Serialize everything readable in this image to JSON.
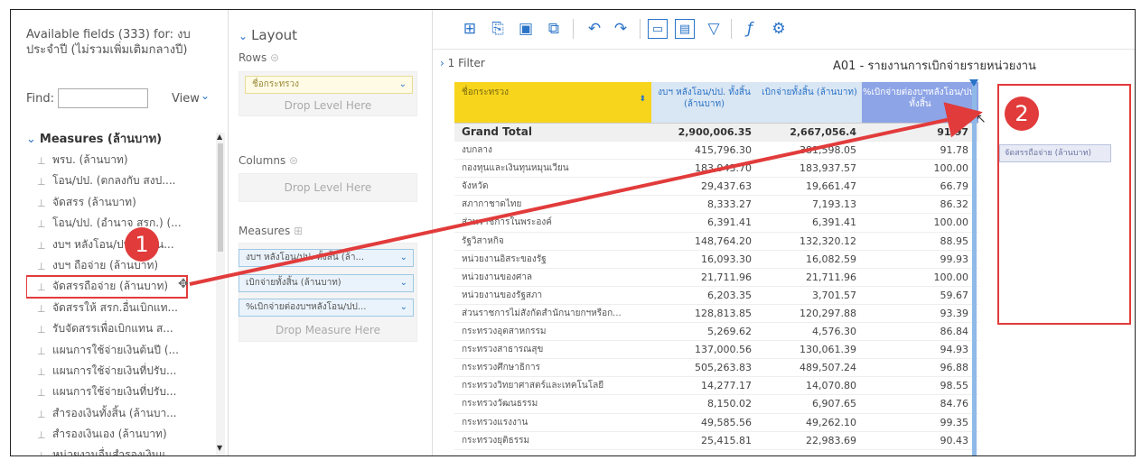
{
  "fields_panel": {
    "title": "Available fields (333) for: งบประจำปี (ไม่รวมเพิ่มเติมกลางปี)",
    "find_label": "Find:",
    "find_value": "",
    "view_label": "View",
    "group_label": "Measures (ล้านบาท)",
    "items": [
      "พรบ. (ล้านบาท)",
      "โอน/ปป. (ตกลงกับ สงป....",
      "จัดสรร (ล้านบาท)",
      "โอน/ปป. (อำนาจ สรก.) (...",
      "งบฯ หลังโอน/ปป. ทั้งสิ้น...",
      "งบฯ ถือจ่าย (ล้านบาท)",
      "จัดสรรถือจ่าย (ล้านบาท)",
      "จัดสรรให้ สรก.อื่นเบิกแท...",
      "รับจัดสรรเพื่อเบิกแทน ส...",
      "แผนการใช้จ่ายเงินต้นปี (...",
      "แผนการใช้จ่ายเงินที่ปรับ...",
      "แผนการใช้จ่ายเงินที่ปรับ...",
      "สำรองเงินทั้งสิ้น (ล้านบา...",
      "สำรองเงินเอง (ล้านบาท)",
      "หน่วยงานอื่นสำรองเงินแ..."
    ]
  },
  "layout_panel": {
    "title": "Layout",
    "rows_label": "Rows",
    "rows_pill": "ชื่อกระทรวง",
    "rows_drop": "Drop Level Here",
    "columns_label": "Columns",
    "columns_drop": "Drop Level Here",
    "measures_label": "Measures",
    "measure_pills": [
      "งบฯ หลังโอน/ปป. ทั้งสิ้น (ล้า...",
      "เบิกจ่ายทั้งสิ้น (ล้านบาท)",
      "%เบิกจ่ายต่องบฯหลังโอน/ปป..."
    ],
    "measures_drop": "Drop Measure Here"
  },
  "toolbar": {
    "icons": [
      "new-icon",
      "open-icon",
      "save-icon",
      "save-as-icon",
      "undo-icon",
      "redo-icon",
      "compact-layout-icon",
      "tabular-layout-icon",
      "filter-icon",
      "clear-format-icon",
      "settings-icon"
    ]
  },
  "filter_bar": {
    "filter_text": "1 Filter",
    "report_title": "A01 - รายงานการเบิกจ่ายรายหน่วยงาน"
  },
  "table": {
    "headers": [
      "ชื่อกระทรวง",
      "งบฯ หลังโอน/ปป. ทั้งสิ้น (ล้านบาท)",
      "เบิกจ่ายทั้งสิ้น (ล้านบาท)",
      "%เบิกจ่ายต่องบฯหลังโอน/ปป. ทั้งสิ้น"
    ],
    "grand_total": [
      "Grand Total",
      "2,900,006.35",
      "2,667,056.4",
      "91.97"
    ],
    "rows": [
      [
        "งบกลาง",
        "415,796.30",
        "381,598.05",
        "91.78"
      ],
      [
        "กองทุนและเงินทุนหมุนเวียน",
        "183,943.70",
        "183,937.57",
        "100.00"
      ],
      [
        "จังหวัด",
        "29,437.63",
        "19,661.47",
        "66.79"
      ],
      [
        "สภากาชาดไทย",
        "8,333.27",
        "7,193.13",
        "86.32"
      ],
      [
        "ส่วนราชการในพระองค์",
        "6,391.41",
        "6,391.41",
        "100.00"
      ],
      [
        "รัฐวิสาหกิจ",
        "148,764.20",
        "132,320.12",
        "88.95"
      ],
      [
        "หน่วยงานอิสระของรัฐ",
        "16,093.30",
        "16,082.59",
        "99.93"
      ],
      [
        "หน่วยงานของศาล",
        "21,711.96",
        "21,711.96",
        "100.00"
      ],
      [
        "หน่วยงานของรัฐสภา",
        "6,203.35",
        "3,701.57",
        "59.67"
      ],
      [
        "ส่วนราชการไม่สังกัดสำนักนายกฯหรือก...",
        "128,813.85",
        "120,297.88",
        "93.39"
      ],
      [
        "กระทรวงอุตสาหกรรม",
        "5,269.62",
        "4,576.30",
        "86.84"
      ],
      [
        "กระทรวงสาธารณสุข",
        "137,000.56",
        "130,061.39",
        "94.93"
      ],
      [
        "กระทรวงศึกษาธิการ",
        "505,263.83",
        "489,507.24",
        "96.88"
      ],
      [
        "กระทรวงวิทยาศาสตร์และเทคโนโลยี",
        "14,277.17",
        "14,070.80",
        "98.55"
      ],
      [
        "กระทรวงวัฒนธรรม",
        "8,150.02",
        "6,907.65",
        "84.76"
      ],
      [
        "กระทรวงแรงงาน",
        "49,585.56",
        "49,262.10",
        "99.35"
      ],
      [
        "กระทรวงยุติธรรม",
        "25,415.81",
        "22,983.69",
        "90.43"
      ]
    ]
  },
  "drag": {
    "chip_label": "จัดสรรถือจ่าย (ล้านบาท)",
    "step1": "1",
    "step2": "2",
    "annotation_color": "#e23b3b"
  }
}
